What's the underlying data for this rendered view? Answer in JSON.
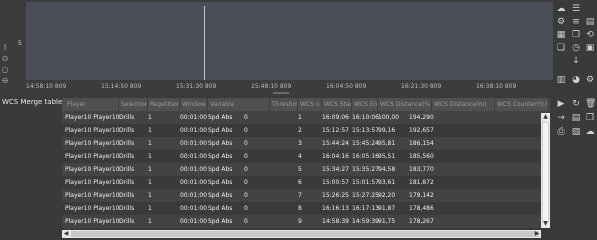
{
  "chart": {
    "y_label": "5",
    "x_ticks": [
      "14:58:10 809",
      "15:14:50 809",
      "15:31:30 809",
      "15:48:10 809",
      "16:04:50 809",
      "16:21:30 809",
      "16:38:10 809"
    ]
  },
  "table": {
    "title": "WCS Merge table",
    "columns": [
      "Player",
      "Selection",
      "Repetition",
      "Window",
      "Variable",
      "Threshold",
      "WCS n",
      "WCS Start",
      "WCS End",
      "WCS Distance(%)",
      "WCS Distance(m)",
      "WCS Counter(%)",
      "WCS Coun"
    ],
    "rows": [
      [
        "Player10 Player10",
        "Drills",
        "1",
        "00:01:00",
        "Spd Abs",
        "0",
        "1",
        "16:09:06",
        "16:10:06",
        "100,00",
        "194,290"
      ],
      [
        "Player10 Player10",
        "Drills",
        "1",
        "00:01:00",
        "Spd Abs",
        "0",
        "2",
        "15:12:57",
        "15:13:57",
        "99,16",
        "192,657"
      ],
      [
        "Player10 Player10",
        "Drills",
        "1",
        "00:01:00",
        "Spd Abs",
        "0",
        "3",
        "15:44:24",
        "15:45:24",
        "95,81",
        "186,154"
      ],
      [
        "Player10 Player10",
        "Drills",
        "1",
        "00:01:00",
        "Spd Abs",
        "0",
        "4",
        "16:04:16",
        "16:05:16",
        "95,51",
        "185,560"
      ],
      [
        "Player10 Player10",
        "Drills",
        "1",
        "00:01:00",
        "Spd Abs",
        "0",
        "5",
        "15:34:27",
        "15:35:27",
        "94,58",
        "183,770"
      ],
      [
        "Player10 Player10",
        "Drills",
        "1",
        "00:01:00",
        "Spd Abs",
        "0",
        "6",
        "15:00:57",
        "15:01:57",
        "93,61",
        "181,872"
      ],
      [
        "Player10 Player10",
        "Drills",
        "1",
        "00:01:00",
        "Spd Abs",
        "0",
        "7",
        "15:26:25",
        "15:27:25",
        "92,20",
        "179,142"
      ],
      [
        "Player10 Player10",
        "Drills",
        "1",
        "00:01:00",
        "Spd Abs",
        "0",
        "8",
        "16:16:13",
        "16:17:13",
        "91,87",
        "178,486"
      ],
      [
        "Player10 Player10",
        "Drills",
        "1",
        "00:01:00",
        "Spd Abs",
        "0",
        "9",
        "14:58:39",
        "14:59:39",
        "91,75",
        "178,267"
      ]
    ]
  },
  "icons": {
    "left_tools": [
      "text-cursor-icon",
      "target-icon",
      "circle-icon",
      "circle-icon"
    ],
    "right_toolbar_top": [
      "cloud-sync-icon",
      "list-icon",
      "settings-icon",
      "list-lines-icon",
      "document-icon",
      "list-detail-icon",
      "copy-icon",
      "history-icon",
      "copy-alt-icon",
      "clock-icon",
      "box-icon",
      "arrow-down-icon",
      "chart-icon",
      "palette-icon",
      "gear-icon"
    ],
    "right_toolbar_bottom": [
      "play-icon",
      "refresh-icon",
      "trash-icon",
      "arrow-right-icon",
      "document-list-icon",
      "copy-doc-icon",
      "print-icon",
      "export-icon",
      "cloud-upload-icon"
    ]
  }
}
